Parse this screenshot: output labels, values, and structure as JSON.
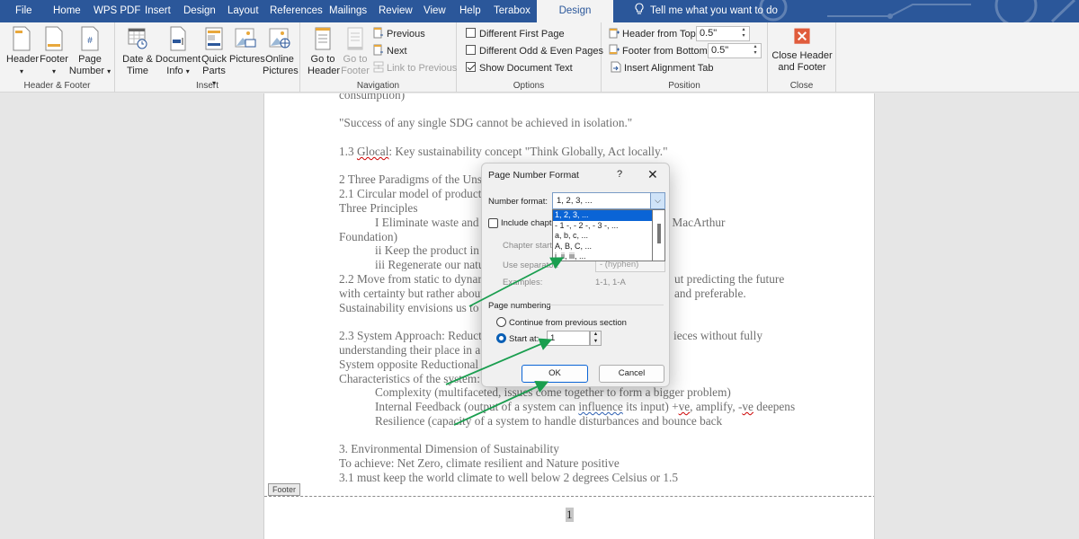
{
  "tabs": {
    "items": [
      "File",
      "Home",
      "WPS PDF",
      "Insert",
      "Design",
      "Layout",
      "References",
      "Mailings",
      "Review",
      "View",
      "Help",
      "Terabox"
    ],
    "active": "Design",
    "tell_me": "Tell me what you want to do"
  },
  "ribbon": {
    "header_footer": {
      "label": "Header & Footer",
      "header": "Header",
      "footer": "Footer",
      "page_number_1": "Page",
      "page_number_2": "Number"
    },
    "insert": {
      "label": "Insert",
      "date_time_1": "Date &",
      "date_time_2": "Time",
      "doc_info_1": "Document",
      "doc_info_2": "Info",
      "quick_parts_1": "Quick",
      "quick_parts_2": "Parts",
      "pictures": "Pictures",
      "online_pictures_1": "Online",
      "online_pictures_2": "Pictures"
    },
    "navigation": {
      "label": "Navigation",
      "goto_header_1": "Go to",
      "goto_header_2": "Header",
      "goto_footer_1": "Go to",
      "goto_footer_2": "Footer",
      "previous": "Previous",
      "next": "Next",
      "link_previous": "Link to Previous"
    },
    "options": {
      "label": "Options",
      "diff_first": "Different First Page",
      "diff_first_checked": false,
      "diff_odd_even": "Different Odd & Even Pages",
      "diff_odd_even_checked": false,
      "show_doc_text": "Show Document Text",
      "show_doc_text_checked": true
    },
    "position": {
      "label": "Position",
      "header_top_label": "Header from Top:",
      "header_top_value": "0.5\"",
      "footer_bottom_label": "Footer from Bottom:",
      "footer_bottom_value": "0.5\"",
      "insert_tab": "Insert Alignment Tab"
    },
    "close": {
      "label": "Close",
      "close_1": "Close Header",
      "close_2": "and Footer",
      "color": "#e05c3c"
    }
  },
  "document": {
    "lines": [
      "consumption)",
      "\"Success of any single SDG cannot be achieved in isolation.\"",
      "1.3 ",
      "Glocal",
      ": Key sustainability concept \"Think Globally, Act locally.\"",
      "2 Three Paradigms of the Uns",
      "2.1 Circular model of product",
      "Three Principles",
      "I Eliminate waste and",
      "Ellen MacArthur",
      "Foundation)",
      "ii Keep the product in",
      "iii Regenerate our natu",
      "2.2 Move from static to dynar",
      "ut predicting the future",
      "with certainty but rather about",
      "and preferable.",
      "Sustainability envisions us to",
      "2.3 System Approach: Reduct",
      "ieces without fully",
      "understanding their place in a",
      "System opposite Reductional",
      "Characteristics of the system:",
      "Complexity (multifaceted, issues come together to form a bigger problem)",
      "Internal Feedback (output of a system can ",
      "influence",
      " its input) +",
      "ve",
      ", amplify, -",
      "ve",
      " deepens",
      "Resilience (capacity of a system to handle disturbances and bounce back",
      "3. Environmental Dimension of Sustainability",
      "To achieve: Net Zero, climate resilient and Nature positive",
      " 3.1 must keep the world climate to well below 2 degrees Celsius or 1.5"
    ],
    "footer_tag": "Footer",
    "page_number": "1"
  },
  "dialog": {
    "title": "Page Number Format",
    "help": "?",
    "close": "✕",
    "number_format_label": "Number format:",
    "number_format_value": "1, 2, 3, ...",
    "options": [
      "1, 2, 3, ...",
      "- 1 -, - 2 -, - 3 -, ...",
      "a, b, c, ...",
      "A, B, C, ...",
      "i, ii, iii, ..."
    ],
    "selected_index": 0,
    "include_chapter": "Include chapter",
    "include_chapter_checked": false,
    "chapter_starts": "Chapter starts",
    "use_separator": "Use separator:",
    "separator_value": "-   (hyphen)",
    "examples_label": "Examples:",
    "examples_value": "1-1, 1-A",
    "page_numbering": "Page numbering",
    "continue_label": "Continue from previous section",
    "continue_selected": false,
    "start_at_label": "Start at:",
    "start_at_selected": true,
    "start_at_value": "1",
    "ok": "OK",
    "cancel": "Cancel"
  },
  "annotations": {
    "arrow_color": "#1a9e4f"
  }
}
